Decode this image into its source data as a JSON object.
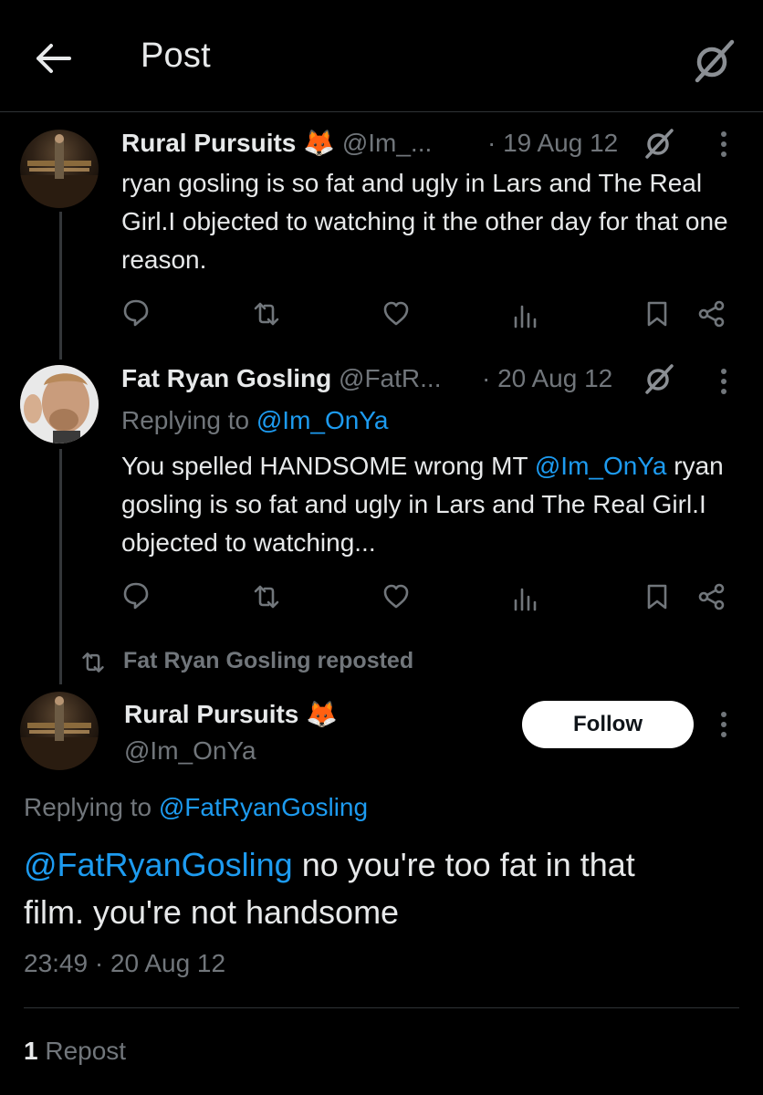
{
  "header": {
    "title": "Post",
    "back_icon": "arrow-left-icon",
    "right_icon": "no-signal-icon"
  },
  "tweets": [
    {
      "name": "Rural Pursuits",
      "emoji": "🦊",
      "handle": "@Im_...",
      "time": "· 19 Aug 12",
      "text": "ryan gosling is so fat and ugly in Lars and The Real Girl.I objected to watching it the other day for that one reason."
    },
    {
      "name": "Fat Ryan Gosling",
      "handle": "@FatR...",
      "time": "· 20 Aug 12",
      "replying_prefix": "Replying to",
      "replying_handle": "@Im_OnYa",
      "text_before": "You spelled HANDSOME wrong MT",
      "text_mention": "@Im_OnYa",
      "text_after": "ryan gosling is so fat and ugly in Lars and The Real Girl.I objected to watching..."
    }
  ],
  "repost_label": "Fat Ryan Gosling reposted",
  "main": {
    "name": "Rural Pursuits",
    "emoji": "🦊",
    "handle": "@Im_OnYa",
    "follow_label": "Follow",
    "replying_prefix": "Replying to",
    "replying_handle": "@FatRyanGosling",
    "mention": "@FatRyanGosling",
    "text_line1": "no you're too fat in that",
    "text_line2": "film. you're not handsome",
    "timestamp": "23:49 · 20 Aug 12",
    "repost_count": "1",
    "repost_label": "Repost"
  },
  "colors": {
    "accent": "#1d9bf0",
    "muted": "#71767b",
    "text": "#e7e9ea",
    "background": "#000000"
  }
}
